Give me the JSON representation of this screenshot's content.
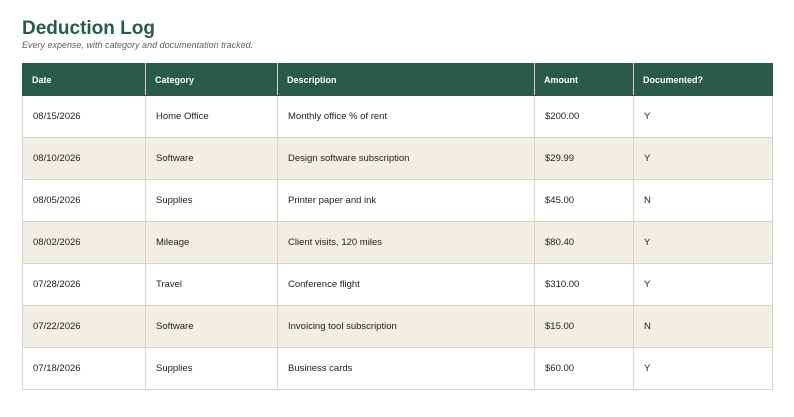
{
  "page": {
    "title": "Deduction Log",
    "subtitle": "Every expense, with category and documentation tracked."
  },
  "table": {
    "headers": [
      "Date",
      "Category",
      "Description",
      "Amount",
      "Documented?"
    ],
    "rows": [
      [
        "08/15/2026",
        "Home Office",
        "Monthly office % of rent",
        "$200.00",
        "Y"
      ],
      [
        "08/10/2026",
        "Software",
        "Design software subscription",
        "$29.99",
        "Y"
      ],
      [
        "08/05/2026",
        "Supplies",
        "Printer paper and ink",
        "$45.00",
        "N"
      ],
      [
        "08/02/2026",
        "Mileage",
        "Client visits, 120 miles",
        "$80.40",
        "Y"
      ],
      [
        "07/28/2026",
        "Travel",
        "Conference flight",
        "$310.00",
        "Y"
      ],
      [
        "07/22/2026",
        "Software",
        "Invoicing tool subscription",
        "$15.00",
        "N"
      ],
      [
        "07/18/2026",
        "Supplies",
        "Business cards",
        "$60.00",
        "Y"
      ]
    ]
  },
  "colors": {
    "header_background": "#2b5a4b",
    "title_text": "#2b5a4b",
    "stripe_row": "#f1eee6",
    "grid_line": "#d8d3c6"
  }
}
